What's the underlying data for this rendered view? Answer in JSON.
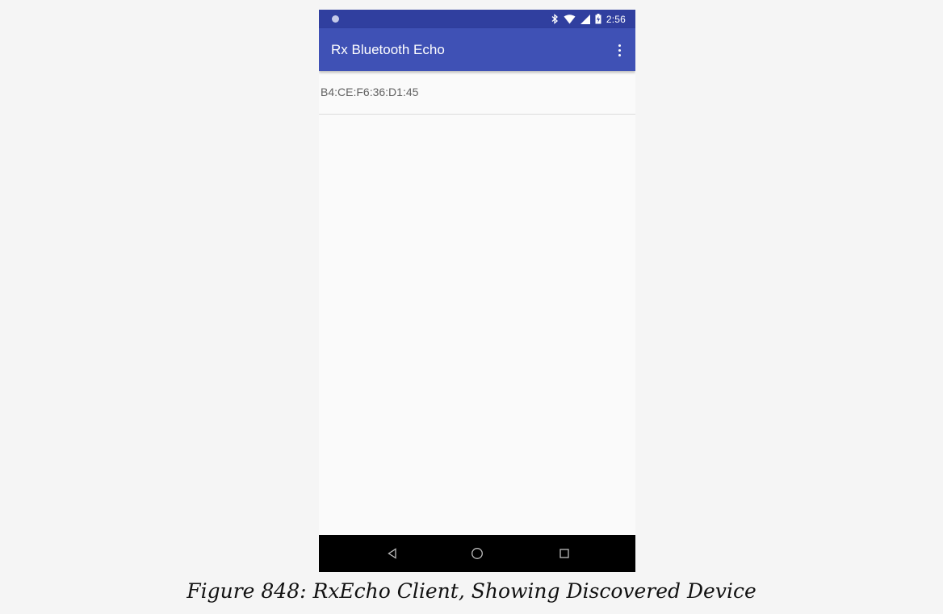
{
  "status_bar": {
    "time": "2:56",
    "icons": [
      "notification-dot-icon",
      "bluetooth-icon",
      "wifi-icon",
      "cell-signal-icon",
      "battery-icon"
    ]
  },
  "app_bar": {
    "title": "Rx Bluetooth Echo",
    "menu_icon": "overflow-menu-icon"
  },
  "device_list": {
    "items": [
      {
        "address": "B4:CE:F6:36:D1:45"
      }
    ]
  },
  "nav_bar": {
    "icons": [
      "back-icon",
      "home-icon",
      "recents-icon"
    ]
  },
  "caption": "Figure 848: RxEcho Client, Showing Discovered Device",
  "colors": {
    "status_bar": "#303f9f",
    "app_bar": "#3f51b5",
    "background": "#fafafa",
    "nav_bar": "#000000"
  }
}
